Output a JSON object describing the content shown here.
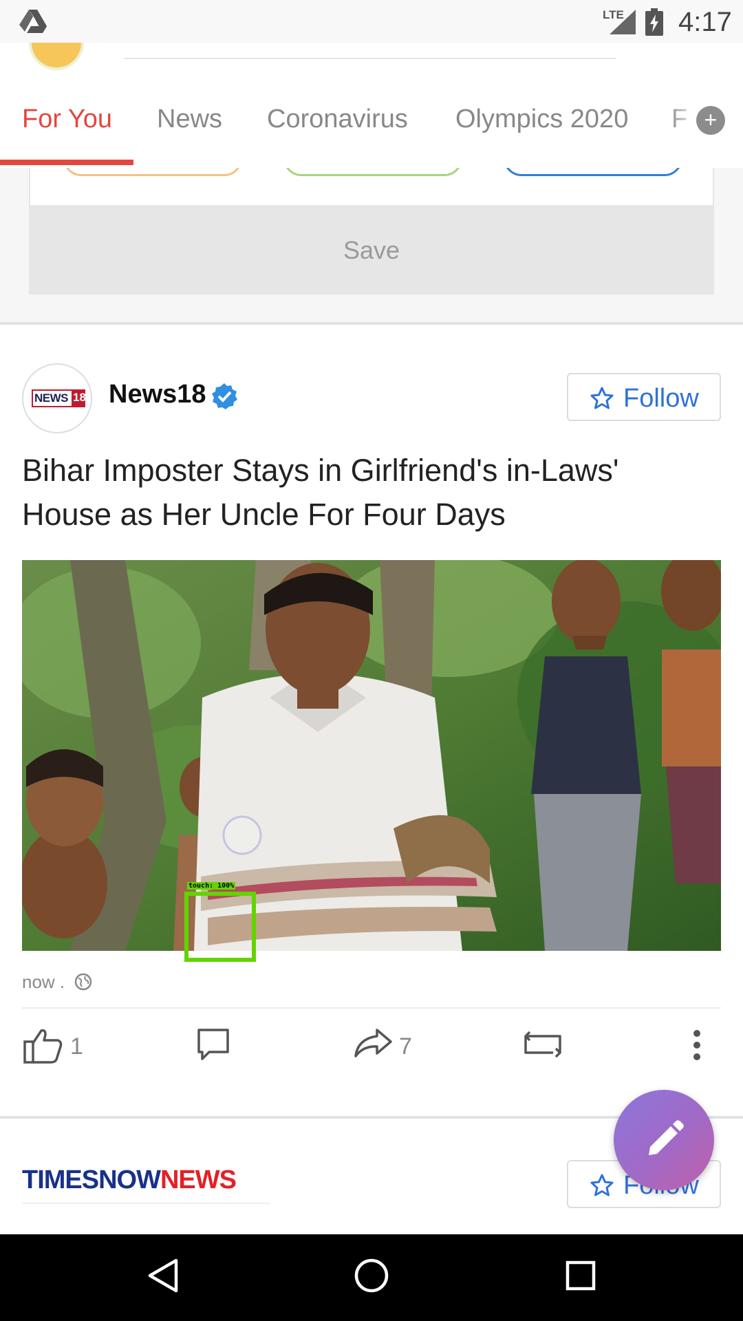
{
  "status_bar": {
    "network_label": "LTE",
    "time": "4:17"
  },
  "tabs": [
    {
      "label": "For You",
      "active": true
    },
    {
      "label": "News",
      "active": false
    },
    {
      "label": "Coronavirus",
      "active": false
    },
    {
      "label": "Olympics 2020",
      "active": false
    },
    {
      "label": "F",
      "active": false
    }
  ],
  "interests_card": {
    "save_label": "Save",
    "pill_colors": [
      "#f3c283",
      "#a6d57f",
      "#2f7fd8"
    ]
  },
  "post": {
    "source_name": "News18",
    "source_logo_text": "NEWS",
    "source_logo_number": "18",
    "follow_label": "Follow",
    "headline": "Bihar Imposter Stays in Girlfriend's in-Laws' House as Her Uncle For Four Days",
    "touch_label": "touch: 100%",
    "time": "now",
    "separator": " .",
    "likes": "1",
    "shares": "7"
  },
  "next_post": {
    "logo_part1": "TIMESNOW",
    "logo_part2": "NEWS",
    "follow_label": "Follow"
  },
  "colors": {
    "accent": "#e2473f",
    "follow_blue": "#2f72d8",
    "touch_box": "#63d400"
  }
}
